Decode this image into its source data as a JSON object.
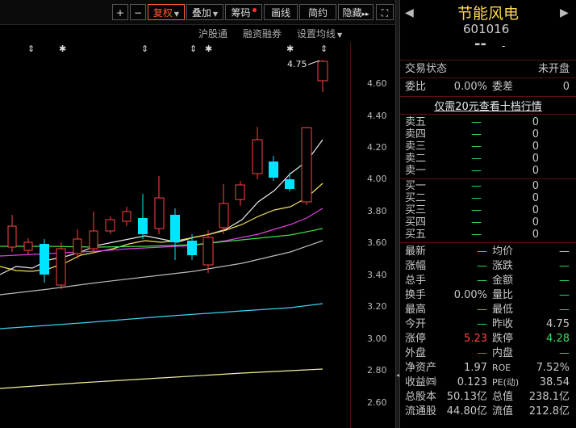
{
  "toolbar": {
    "plus": "+",
    "minus": "−",
    "fuquan": "复权",
    "diejia": "叠加",
    "chouma": "筹码",
    "huaxian": "画线",
    "jianyue": "简约",
    "yincang": "隐藏",
    "yincang_arrow": "▸▸",
    "expand": "⛶"
  },
  "subbar": {
    "hgt": "沪股通",
    "rzrq": "融资融券",
    "setma": "设置均线"
  },
  "price_axis": [
    "4.60",
    "4.40",
    "4.20",
    "4.00",
    "3.80",
    "3.60",
    "3.40",
    "3.20",
    "3.00",
    "2.80",
    "2.60"
  ],
  "chart_annotations": {
    "high_label": "4.75"
  },
  "stock": {
    "name": "节能风电",
    "code": "601016",
    "price": "--",
    "change": "-",
    "change_pct": "-"
  },
  "status": {
    "trade_state_label": "交易状态",
    "trade_state": "未开盘",
    "weibi_label": "委比",
    "weibi": "0.00%",
    "weicha_label": "委差",
    "weicha": "0"
  },
  "promo": "仅需20元查看十档行情",
  "sell_levels": [
    {
      "label": "卖五",
      "price": "—",
      "vol": "0"
    },
    {
      "label": "卖四",
      "price": "—",
      "vol": "0"
    },
    {
      "label": "卖三",
      "price": "—",
      "vol": "0"
    },
    {
      "label": "卖二",
      "price": "—",
      "vol": "0"
    },
    {
      "label": "卖一",
      "price": "—",
      "vol": "0"
    }
  ],
  "buy_levels": [
    {
      "label": "买一",
      "price": "—",
      "vol": "0"
    },
    {
      "label": "买二",
      "price": "—",
      "vol": "0"
    },
    {
      "label": "买三",
      "price": "—",
      "vol": "0"
    },
    {
      "label": "买四",
      "price": "—",
      "vol": "0"
    },
    {
      "label": "买五",
      "price": "—",
      "vol": "0"
    }
  ],
  "quote": [
    {
      "l1": "最新",
      "v1": "—",
      "l2": "均价",
      "v2": "—"
    },
    {
      "l1": "涨幅",
      "v1": "—",
      "l2": "涨跌",
      "v2": "—"
    },
    {
      "l1": "总手",
      "v1": "—",
      "l2": "金额",
      "v2": "—"
    },
    {
      "l1": "换手",
      "v1": "0.00%",
      "l2": "量比",
      "v2": "—"
    },
    {
      "l1": "最高",
      "v1": "—",
      "l2": "最低",
      "v2": "—"
    },
    {
      "l1": "今开",
      "v1": "—",
      "l2": "昨收",
      "v2": "4.75"
    },
    {
      "l1": "涨停",
      "v1": "5.23",
      "l2": "跌停",
      "v2": "4.28"
    },
    {
      "l1": "外盘",
      "v1": "—",
      "l2": "内盘",
      "v2": "—"
    },
    {
      "l1": "净资产",
      "v1": "1.97",
      "l2": "ROE",
      "v2": "7.52%"
    },
    {
      "l1": "收益㈣",
      "v1": "0.123",
      "l2": "PE(动)",
      "v2": "38.54"
    },
    {
      "l1": "总股本",
      "v1": "50.13亿",
      "l2": "总值",
      "v2": "238.1亿"
    },
    {
      "l1": "流通股",
      "v1": "44.80亿",
      "l2": "流值",
      "v2": "212.8亿"
    }
  ],
  "colors": {
    "up": "#ff4444",
    "down": "#00e5ff",
    "flat_dash": "#33dd66"
  }
}
